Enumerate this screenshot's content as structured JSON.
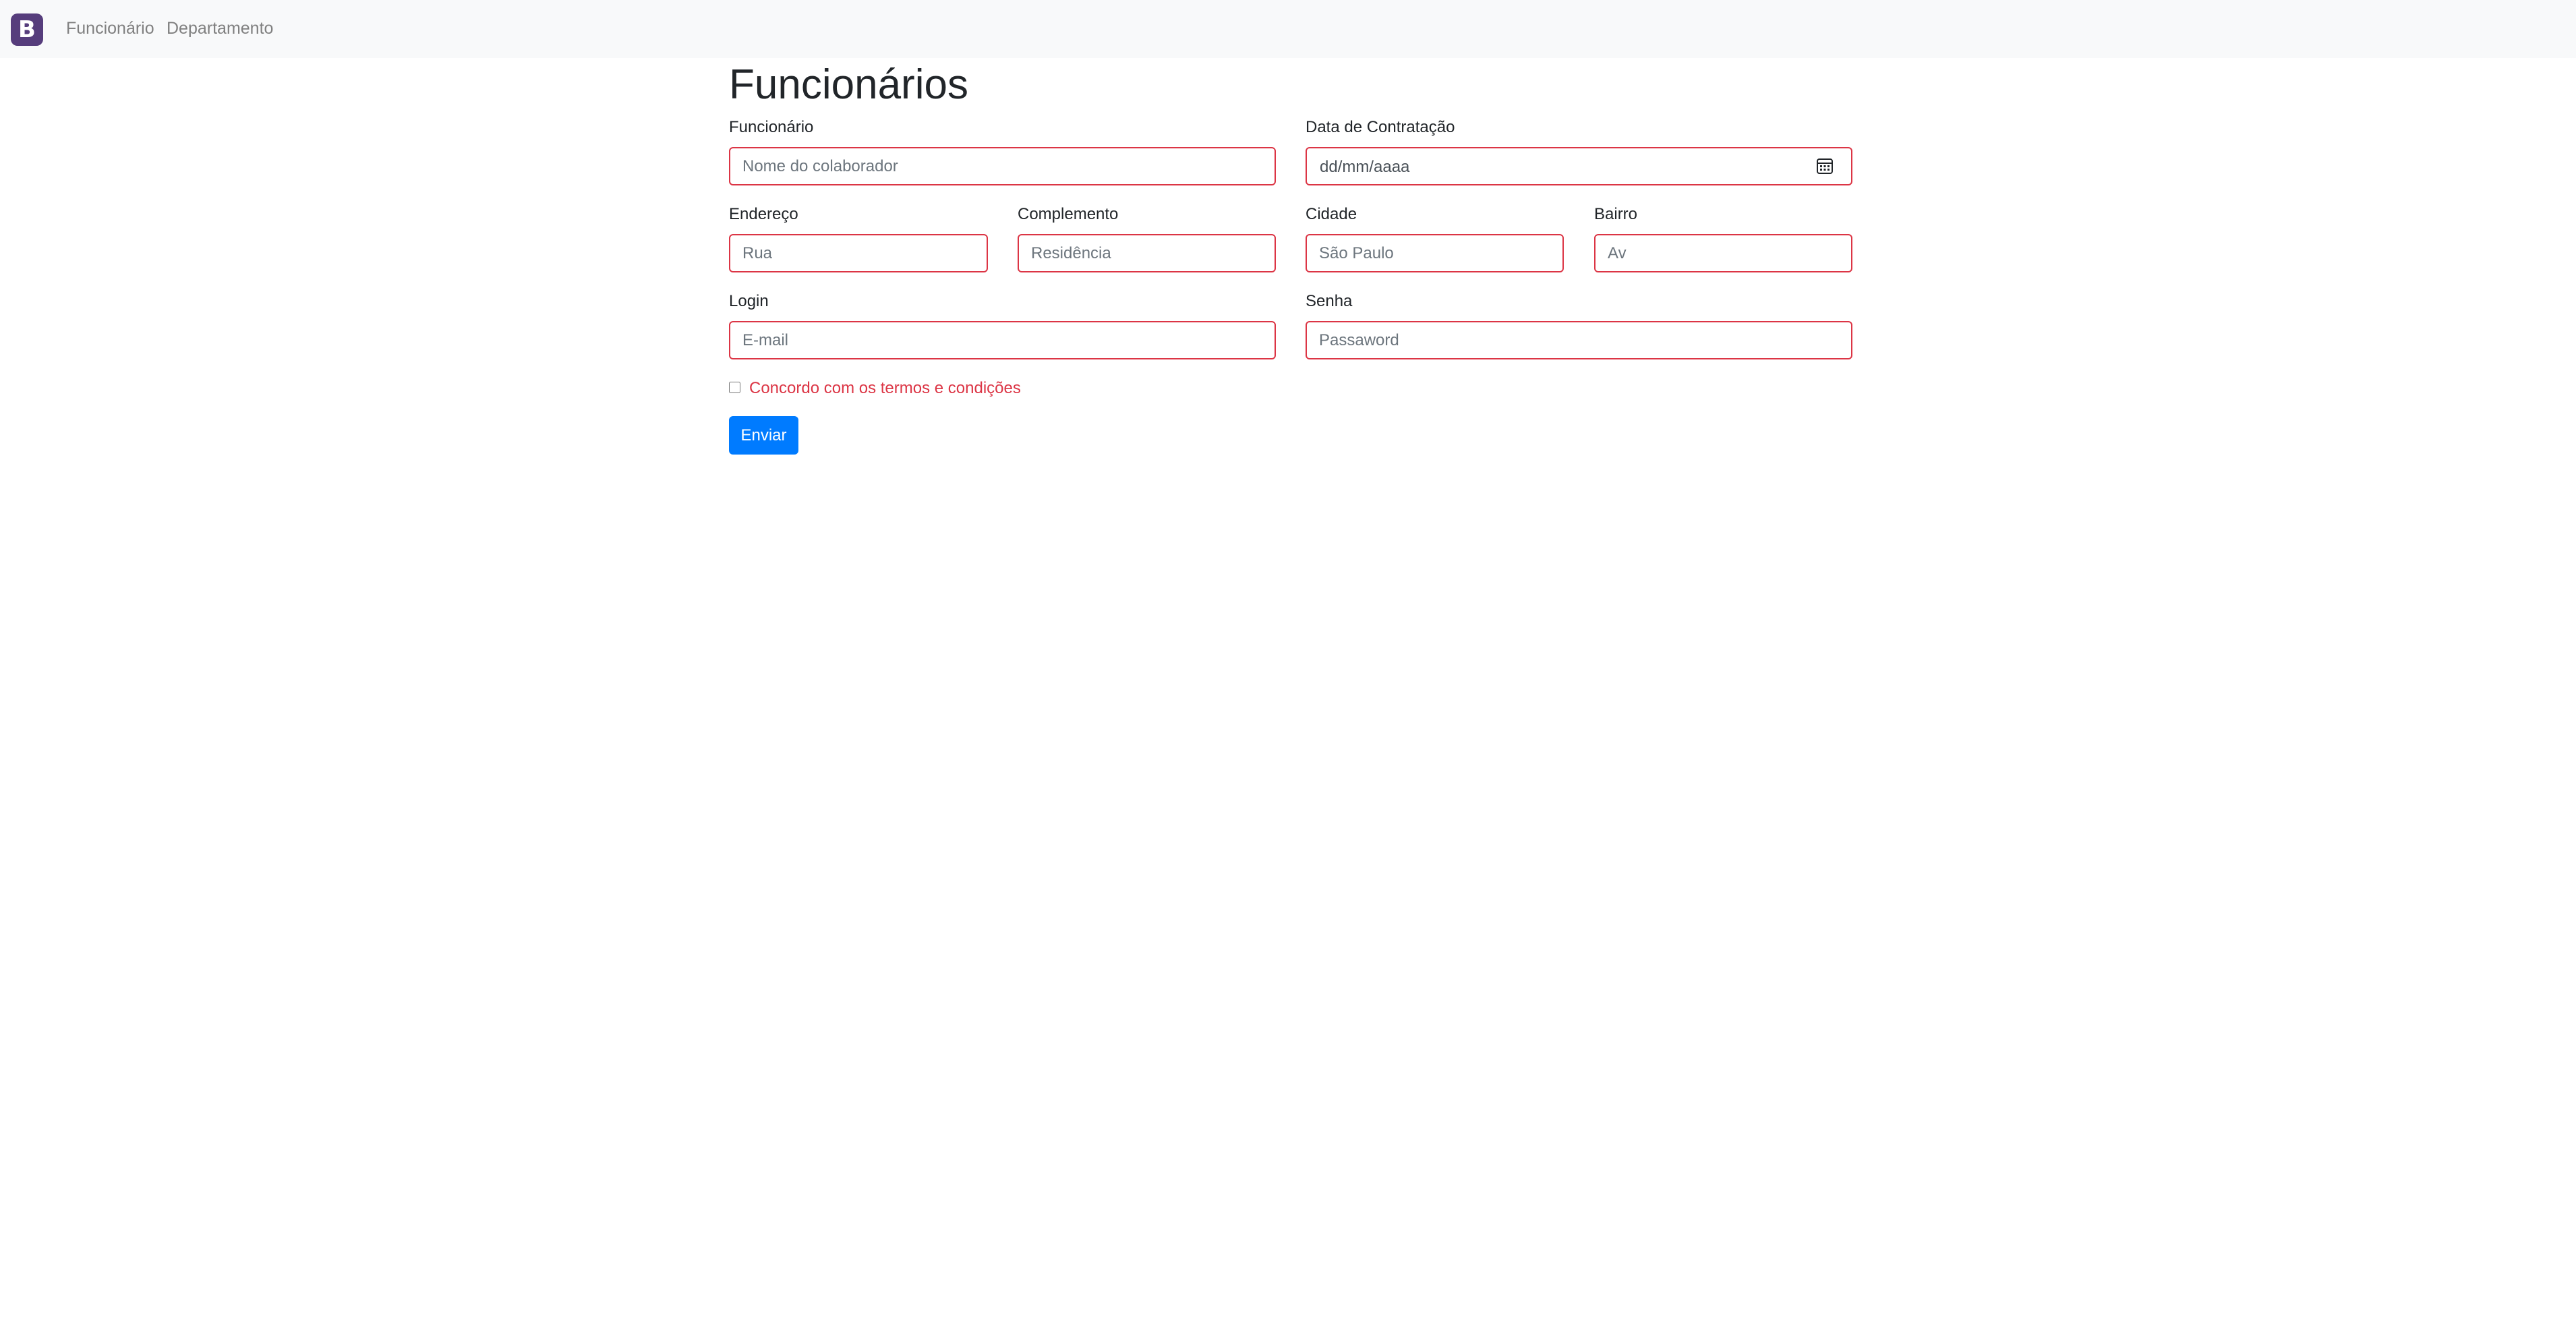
{
  "navbar": {
    "brand": "B",
    "links": [
      "Funcionário",
      "Departamento"
    ]
  },
  "page": {
    "title": "Funcionários"
  },
  "form": {
    "funcionario": {
      "label": "Funcionário",
      "placeholder": "Nome do colaborador"
    },
    "data_contratacao": {
      "label": "Data de Contratação",
      "value": "dd/mm/aaaa"
    },
    "endereco": {
      "label": "Endereço",
      "placeholder": "Rua"
    },
    "complemento": {
      "label": "Complemento",
      "placeholder": "Residência"
    },
    "cidade": {
      "label": "Cidade",
      "placeholder": "São Paulo"
    },
    "bairro": {
      "label": "Bairro",
      "placeholder": "Av"
    },
    "login": {
      "label": "Login",
      "placeholder": "E-mail"
    },
    "senha": {
      "label": "Senha",
      "placeholder": "Passaword"
    },
    "termos": {
      "label": "Concordo com os termos e condições",
      "checked": false
    },
    "submit": {
      "label": "Enviar"
    }
  },
  "colors": {
    "navbar_bg": "#f8f9fa",
    "brand_bg": "#563d7c",
    "invalid": "#dc3545",
    "primary": "#007bff"
  },
  "icons": {
    "calendar": "calendar-icon"
  }
}
